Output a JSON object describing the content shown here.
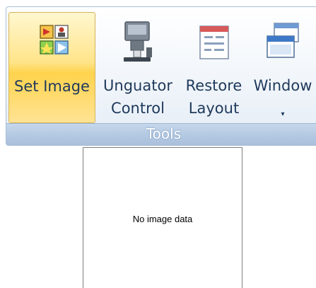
{
  "ribbon": {
    "group_label": "Tools",
    "buttons": [
      {
        "id": "set-image",
        "label": "Set Image",
        "icon": "set-image-icon",
        "selected": true
      },
      {
        "id": "unguator-control",
        "label": "Unguator Control",
        "label_line1": "Unguator",
        "label_line2": "Control",
        "icon": "unguator-device-icon"
      },
      {
        "id": "restore-layout",
        "label": "Restore Layout",
        "label_line1": "Restore",
        "label_line2": "Layout",
        "icon": "restore-layout-icon"
      },
      {
        "id": "window",
        "label": "Window",
        "icon": "window-icon",
        "has_dropdown": true,
        "dropdown_arrow": "▾"
      }
    ]
  },
  "image_panel": {
    "message": "No image data"
  },
  "colors": {
    "selected_button_top": "#fff7cf",
    "selected_button_bottom": "#ffd34d",
    "label_text": "#15428b",
    "group_footer": "#b5cae3"
  }
}
